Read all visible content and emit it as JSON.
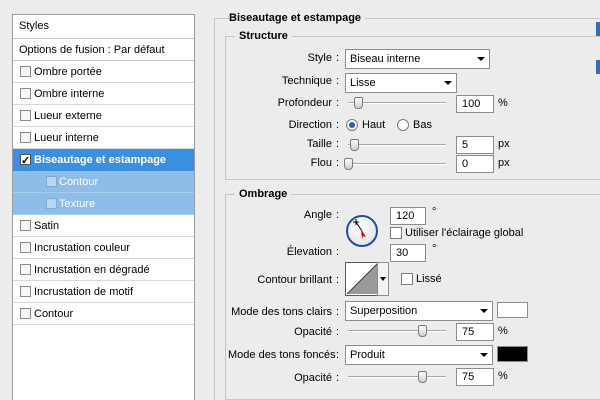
{
  "styles_panel": {
    "header": "Styles",
    "fusion": "Options de fusion : Par défaut",
    "items": [
      {
        "label": "Ombre portée",
        "checked": false,
        "active": false,
        "sub": false
      },
      {
        "label": "Ombre interne",
        "checked": false,
        "active": false,
        "sub": false
      },
      {
        "label": "Lueur externe",
        "checked": false,
        "active": false,
        "sub": false
      },
      {
        "label": "Lueur interne",
        "checked": false,
        "active": false,
        "sub": false
      },
      {
        "label": "Biseautage et estampage",
        "checked": true,
        "active": true,
        "sub": false
      },
      {
        "label": "Contour",
        "checked": false,
        "active": false,
        "sub": true
      },
      {
        "label": "Texture",
        "checked": false,
        "active": false,
        "sub": true
      },
      {
        "label": "Satin",
        "checked": false,
        "active": false,
        "sub": false
      },
      {
        "label": "Incrustation couleur",
        "checked": false,
        "active": false,
        "sub": false
      },
      {
        "label": "Incrustation en dégradé",
        "checked": false,
        "active": false,
        "sub": false
      },
      {
        "label": "Incrustation de motif",
        "checked": false,
        "active": false,
        "sub": false
      },
      {
        "label": "Contour",
        "checked": false,
        "active": false,
        "sub": false
      }
    ]
  },
  "main_title": "Biseautage et estampage",
  "structure": {
    "title": "Structure",
    "style_label": "Style",
    "style_value": "Biseau interne",
    "technique_label": "Technique",
    "technique_value": "Lisse",
    "profondeur_label": "Profondeur",
    "profondeur_value": "100",
    "profondeur_unit": "%",
    "profondeur_fraction": 0.1,
    "direction_label": "Direction",
    "direction_haut": "Haut",
    "direction_bas": "Bas",
    "direction_selected": "Haut",
    "taille_label": "Taille",
    "taille_value": "5",
    "taille_unit": "px",
    "taille_fraction": 0.06,
    "flou_label": "Flou",
    "flou_value": "0",
    "flou_unit": "px",
    "flou_fraction": 0.0
  },
  "ombrage": {
    "title": "Ombrage",
    "angle_label": "Angle",
    "angle_value": "120",
    "angle_unit": "°",
    "global_light_label": "Utiliser l'éclairage global",
    "global_light_checked": false,
    "elevation_label": "Élevation",
    "elevation_value": "30",
    "elevation_unit": "°",
    "contour_label": "Contour brillant",
    "lisse_label": "Lissé",
    "lisse_checked": false,
    "highlight_mode_label": "Mode des tons clairs",
    "highlight_mode_value": "Superposition",
    "highlight_color": "#ffffff",
    "highlight_opacity_label": "Opacité",
    "highlight_opacity_value": "75",
    "highlight_opacity_unit": "%",
    "highlight_opacity_fraction": 0.75,
    "shadow_mode_label": "Mode des tons foncés",
    "shadow_mode_value": "Produit",
    "shadow_color": "#000000",
    "shadow_opacity_label": "Opacité",
    "shadow_opacity_value": "75",
    "shadow_opacity_unit": "%",
    "shadow_opacity_fraction": 0.75
  }
}
